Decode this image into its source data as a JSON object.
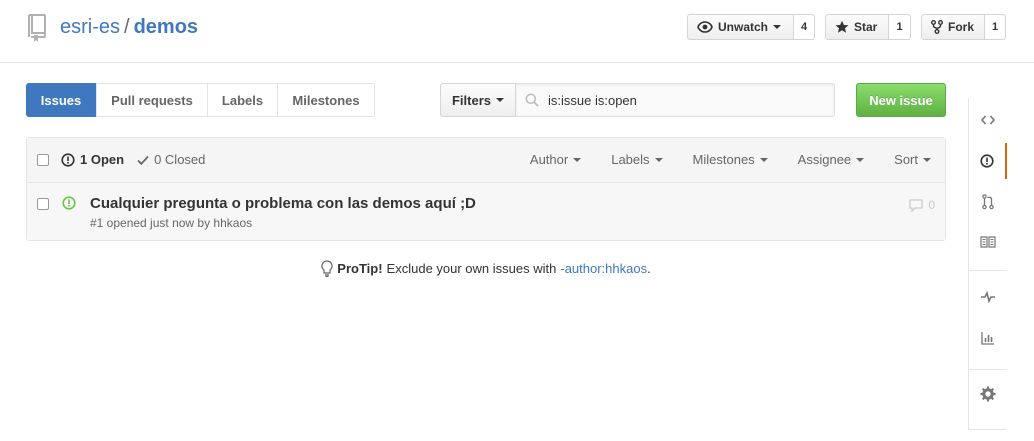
{
  "repo": {
    "owner": "esri-es",
    "separator": "/",
    "name": "demos"
  },
  "actions": {
    "watch": {
      "label": "Unwatch",
      "count": "4"
    },
    "star": {
      "label": "Star",
      "count": "1"
    },
    "fork": {
      "label": "Fork",
      "count": "1"
    }
  },
  "subnav": {
    "tabs": [
      {
        "label": "Issues",
        "selected": true
      },
      {
        "label": "Pull requests"
      },
      {
        "label": "Labels"
      },
      {
        "label": "Milestones"
      }
    ],
    "filters_label": "Filters",
    "search_value": "is:issue is:open",
    "new_issue_label": "New issue"
  },
  "table": {
    "open_label": "1 Open",
    "closed_label": "0 Closed",
    "menus": [
      "Author",
      "Labels",
      "Milestones",
      "Assignee",
      "Sort"
    ],
    "issues": [
      {
        "title": "Cualquier pregunta o problema con las demos aquí ;D",
        "meta": "#1 opened just now by hhkaos",
        "comments": "0"
      }
    ]
  },
  "protip": {
    "strong": "ProTip!",
    "text": "Exclude your own issues with",
    "link": "-author:hhkaos",
    "end": "."
  },
  "sidebar": {
    "icons": [
      "code-icon",
      "issue-icon",
      "pull-request-icon",
      "wiki-icon",
      "pulse-icon",
      "graph-icon",
      "settings-icon"
    ]
  },
  "colors": {
    "link": "#4078c0",
    "selected_tab": "#4078c0",
    "new_issue": "#6cc644",
    "open_issue": "#6cc644",
    "sidebar_selected": "#d26911"
  }
}
